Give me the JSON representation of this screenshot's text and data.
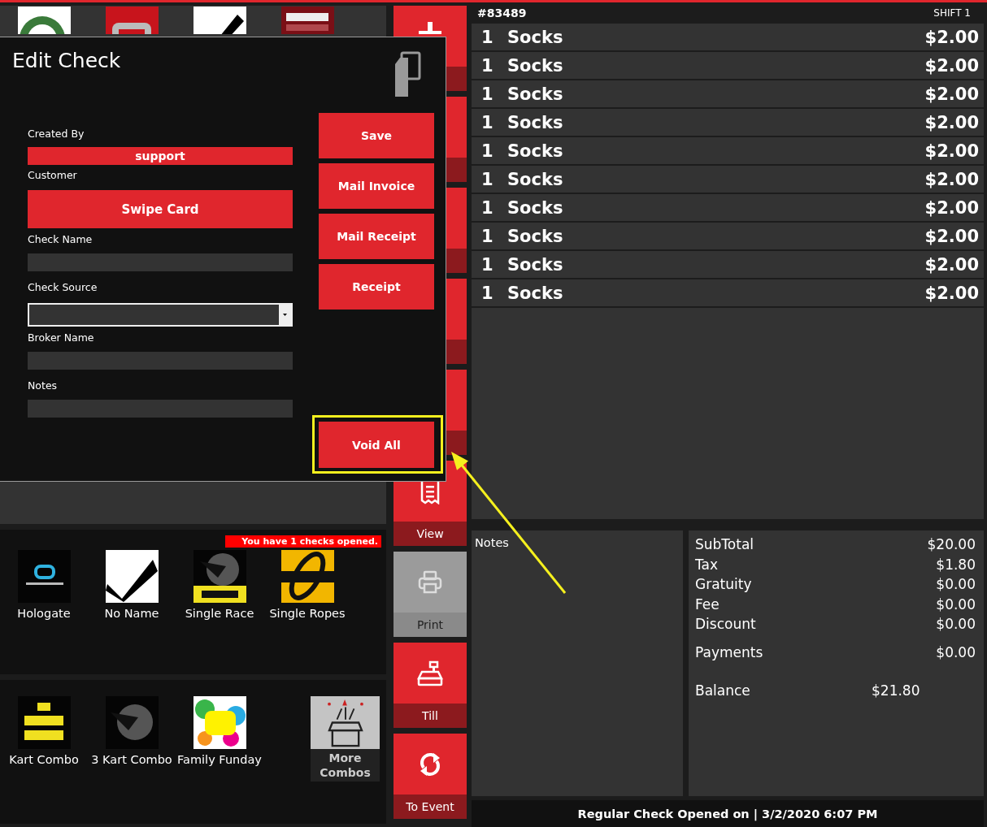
{
  "product_panels": [
    {
      "badge": "You have 1 checks opened.",
      "tiles": [
        {
          "name": "Hologate",
          "kind": "picture"
        },
        {
          "name": "No Name",
          "kind": "picture"
        },
        {
          "name": "Single Race",
          "kind": "picture"
        },
        {
          "name": "Single Ropes",
          "kind": "picture"
        }
      ]
    },
    {
      "tiles": [
        {
          "name": "Kart Combo",
          "kind": "picture"
        },
        {
          "name": "3 Kart Combo",
          "kind": "picture"
        },
        {
          "name": "Family Funday",
          "kind": "picture"
        },
        {
          "name": "More Combos",
          "kind": "more"
        }
      ]
    }
  ],
  "side_buttons": [
    {
      "kind": "blank"
    },
    {
      "kind": "blank"
    },
    {
      "kind": "blank"
    },
    {
      "kind": "blank"
    },
    {
      "kind": "blank"
    },
    {
      "kind": "labeled",
      "label": "View",
      "disabled": false
    },
    {
      "kind": "labeled",
      "label": "Print",
      "disabled": true
    },
    {
      "kind": "labeled",
      "label": "Till",
      "disabled": false
    },
    {
      "kind": "labeled",
      "label": "To Event",
      "disabled": false
    }
  ],
  "check": {
    "number": "#83489",
    "shift": "SHIFT 1",
    "items": [
      {
        "qty": "1",
        "name": "Socks",
        "price": "$2.00"
      },
      {
        "qty": "1",
        "name": "Socks",
        "price": "$2.00"
      },
      {
        "qty": "1",
        "name": "Socks",
        "price": "$2.00"
      },
      {
        "qty": "1",
        "name": "Socks",
        "price": "$2.00"
      },
      {
        "qty": "1",
        "name": "Socks",
        "price": "$2.00"
      },
      {
        "qty": "1",
        "name": "Socks",
        "price": "$2.00"
      },
      {
        "qty": "1",
        "name": "Socks",
        "price": "$2.00"
      },
      {
        "qty": "1",
        "name": "Socks",
        "price": "$2.00"
      },
      {
        "qty": "1",
        "name": "Socks",
        "price": "$2.00"
      },
      {
        "qty": "1",
        "name": "Socks",
        "price": "$2.00"
      }
    ]
  },
  "notes": {
    "label": "Notes"
  },
  "totals": [
    {
      "label": "SubTotal",
      "value": "$20.00"
    },
    {
      "label": "Tax",
      "value": "$1.80"
    },
    {
      "label": "Gratuity",
      "value": "$0.00"
    },
    {
      "label": "Fee",
      "value": "$0.00"
    },
    {
      "label": "Discount",
      "value": "$0.00"
    },
    {
      "label": "Payments",
      "value": "$0.00"
    }
  ],
  "balance": {
    "label": "Balance",
    "value": "$21.80"
  },
  "footer": "Regular Check Opened on | 3/2/2020 6:07 PM",
  "dialog": {
    "title": "Edit Check",
    "fields": [
      {
        "label": "Created By",
        "kind": "button",
        "value": "support"
      },
      {
        "label": "Customer",
        "kind": "bigbutton",
        "value": "Swipe Card"
      },
      {
        "label": "Check Name",
        "kind": "text"
      },
      {
        "label": "Check Source",
        "kind": "dropdown"
      },
      {
        "label": "Broker Name",
        "kind": "text"
      },
      {
        "label": "Notes",
        "kind": "text"
      }
    ],
    "buttons": [
      "Save",
      "Mail Invoice",
      "Mail Receipt",
      "Receipt"
    ],
    "void_button": {
      "label": "Void All",
      "highlighted": true
    }
  }
}
